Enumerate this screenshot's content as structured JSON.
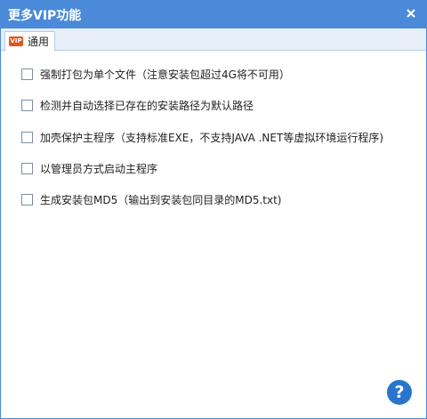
{
  "window": {
    "title": "更多VIP功能",
    "title_bar_color": "#4a8ad8"
  },
  "tabs": [
    {
      "label": "通用",
      "icon": "vip-icon",
      "icon_text": "VIP",
      "selected": true
    }
  ],
  "options": [
    {
      "label": "强制打包为单个文件（注意安装包超过4G将不可用）",
      "checked": false
    },
    {
      "label": "检测并自动选择已存在的安装路径为默认路径",
      "checked": false
    },
    {
      "label": "加壳保护主程序（支持标准EXE，不支持JAVA .NET等虚拟环境运行程序)",
      "checked": false
    },
    {
      "label": "以管理员方式启动主程序",
      "checked": false
    },
    {
      "label": "生成安装包MD5（输出到安装包同目录的MD5.txt)",
      "checked": false
    }
  ],
  "help": {
    "label": "?",
    "icon": "help-icon"
  }
}
